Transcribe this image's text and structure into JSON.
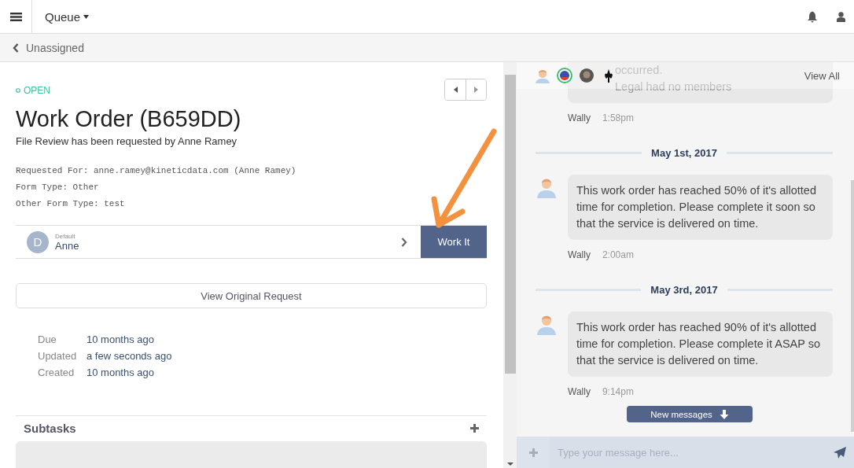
{
  "header": {
    "title": "Queue"
  },
  "breadcrumb": {
    "back_label": "Unassigned"
  },
  "work_order": {
    "status": "OPEN",
    "title": "Work Order (B659DD)",
    "subtitle": "File Review has been requested by Anne Ramey",
    "details": [
      "Requested For: anne.ramey@kineticdata.com (Anne Ramey)",
      "Form Type: Other",
      "Other Form Type: test"
    ],
    "assignment": {
      "avatar_letter": "D",
      "team": "Default",
      "assignee": "Anne"
    },
    "work_button": "Work It",
    "view_button": "View Original Request",
    "dates": [
      {
        "label": "Due",
        "value": "10 months ago"
      },
      {
        "label": "Updated",
        "value": "a few seconds ago"
      },
      {
        "label": "Created",
        "value": "10 months ago"
      }
    ],
    "subtasks": {
      "title": "Subtasks"
    }
  },
  "chat": {
    "participants": [
      {
        "kind": "person"
      },
      {
        "kind": "badge"
      },
      {
        "kind": "photo"
      },
      {
        "kind": "emblem"
      }
    ],
    "view_all": "View All",
    "items": [
      {
        "kind": "message",
        "lines": [
          "occurred.",
          "Legal had no members"
        ],
        "author": "Wally",
        "time": "1:58pm"
      },
      {
        "kind": "divider",
        "text": "May 1st, 2017"
      },
      {
        "kind": "message",
        "lines": [
          "This work order has reached 50% of it's allotted time for completion. Please complete it soon so that the service is delivered on time."
        ],
        "author": "Wally",
        "time": "2:00am"
      },
      {
        "kind": "divider",
        "text": "May 3rd, 2017"
      },
      {
        "kind": "message",
        "lines": [
          "This work order has reached 90% of it's allotted time for completion. Please complete it ASAP so that the service is delivered on time."
        ],
        "author": "Wally",
        "time": "9:14pm"
      }
    ],
    "new_messages": "New messages",
    "composer": {
      "placeholder": "Type your message here..."
    }
  }
}
